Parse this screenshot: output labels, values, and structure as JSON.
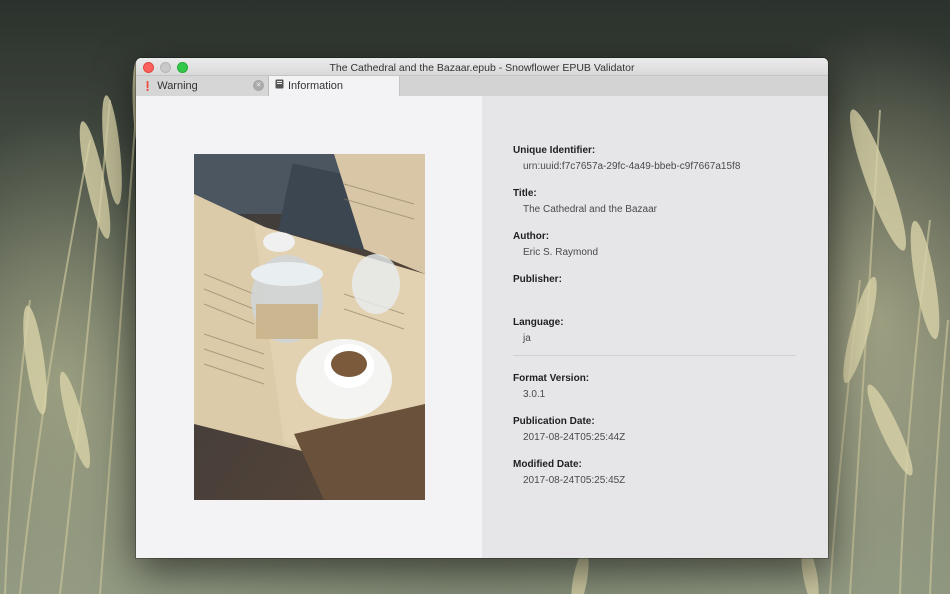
{
  "window": {
    "title": "The Cathedral and the Bazaar.epub - Snowflower EPUB Validator"
  },
  "tabs": [
    {
      "label": "Warning",
      "icon": "exclamation-icon"
    },
    {
      "label": "Information",
      "icon": "book-icon"
    }
  ],
  "info": {
    "unique_identifier": {
      "label": "Unique Identifier:",
      "value": "urn:uuid:f7c7657a-29fc-4a49-bbeb-c9f7667a15f8"
    },
    "title": {
      "label": "Title:",
      "value": "The Cathedral and the Bazaar"
    },
    "author": {
      "label": "Author:",
      "value": "Eric S. Raymond"
    },
    "publisher": {
      "label": "Publisher:",
      "value": ""
    },
    "language": {
      "label": "Language:",
      "value": "ja"
    },
    "format_version": {
      "label": "Format Version:",
      "value": "3.0.1"
    },
    "publication_date": {
      "label": "Publication Date:",
      "value": "2017-08-24T05:25:44Z"
    },
    "modified_date": {
      "label": "Modified Date:",
      "value": "2017-08-24T05:25:45Z"
    }
  },
  "colors": {
    "close": "#fc605c",
    "minimize": "#c9c9c9",
    "maximize": "#34c84a"
  }
}
